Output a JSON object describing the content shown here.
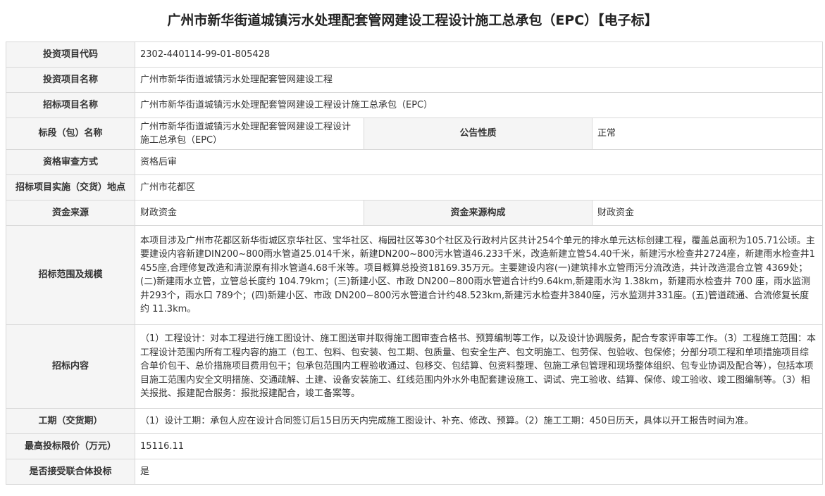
{
  "title": "广州市新华街道城镇污水处理配套管网建设工程设计施工总承包（EPC）【电子标】",
  "rows": {
    "project_code": {
      "label": "投资项目代码",
      "value": "2302-440114-99-01-805428"
    },
    "project_name": {
      "label": "投资项目名称",
      "value": "广州市新华街道城镇污水处理配套管网建设工程"
    },
    "tender_name": {
      "label": "招标项目名称",
      "value": "广州市新华街道城镇污水处理配套管网建设工程设计施工总承包（EPC）"
    },
    "section_name": {
      "label": "标段（包）名称",
      "value": "广州市新华街道城镇污水处理配套管网建设工程设计施工总承包（EPC）",
      "label2": "公告性质",
      "value2": "正常"
    },
    "qualification": {
      "label": "资格审查方式",
      "value": "资格后审"
    },
    "location": {
      "label": "招标项目实施（交货）地点",
      "value": "广州市花都区"
    },
    "funding": {
      "label": "资金来源",
      "value": "财政资金",
      "label2": "资金来源构成",
      "value2": "财政资金"
    },
    "scope": {
      "label": "招标范围及规模",
      "value": "本项目涉及广州市花都区新华街城区京华社区、宝华社区、梅园社区等30个社区及行政村片区共计254个单元的排水单元达标创建工程，覆盖总面积为105.71公顷。主要建设内容新建DIN200~800雨水管道25.014千米，新建DN200~800污水管道46.233千米，改造新建立管54.40千米，新建污水检查井2724座，新建雨水检查井1455座,合理修复改造和清淤原有排水管道4.68千米等。项目概算总投资18169.35万元。主要建设内容(一)建筑排水立管雨污分流改造，共计改造混合立管 4369处；(二)新建雨水立管，立管总长度约 104.79km；(三)新建小区、市政 DN200~800雨水管道合计约9.64km,新建雨水沟 1.38km，新建雨水检查井 700 座，雨水监测井293个，雨水口 789个；(四)新建小区、市政 DN200~800污水管道合计约48.523km,新建污水检查井3840座，污水监测井331座。(五)管道疏通、合流修复长度约 11.3km。"
    },
    "content": {
      "label": "招标内容",
      "value": "（1）工程设计：对本工程进行施工图设计、施工图送审并取得施工图审查合格书、预算编制等工作，以及设计协调服务，配合专家评审等工作。（3）工程施工范围：本工程设计范围内所有工程内容的施工（包工、包料、包安装、包工期、包质量、包安全生产、包文明施工、包劳保、包验收、包保修；分部分项工程和单项措施项目综合单价包干、总价措施项目费用包干；包承包范围内工程验收通过、包移交、包结算、包资料整理、包施工承包管理和现场整体组织、包专业协调及配合等），包括本项目施工范围内安全文明措施、交通疏解、土建、设备安装施工、红线范围内外水外电配套建设施工、调试、完工验收、结算、保修、竣工验收、竣工图编制等。（3）相关报批、报建配合服务：报批报建配合，竣工备案等。"
    },
    "duration": {
      "label": "工期（交货期）",
      "value": "（1）设计工期：承包人应在设计合同签订后15日历天内完成施工图设计、补充、修改、预算。（2）施工工期：450日历天，具体以开工报告时间为准。"
    },
    "max_price": {
      "label": "最高投标限价（万元）",
      "value": "15116.11"
    },
    "joint_bid": {
      "label": "是否接受联合体投标",
      "value": "是"
    }
  },
  "colors": {
    "label_bg": "#f5f5f5",
    "border": "#d9d9d9",
    "text": "#333333"
  }
}
